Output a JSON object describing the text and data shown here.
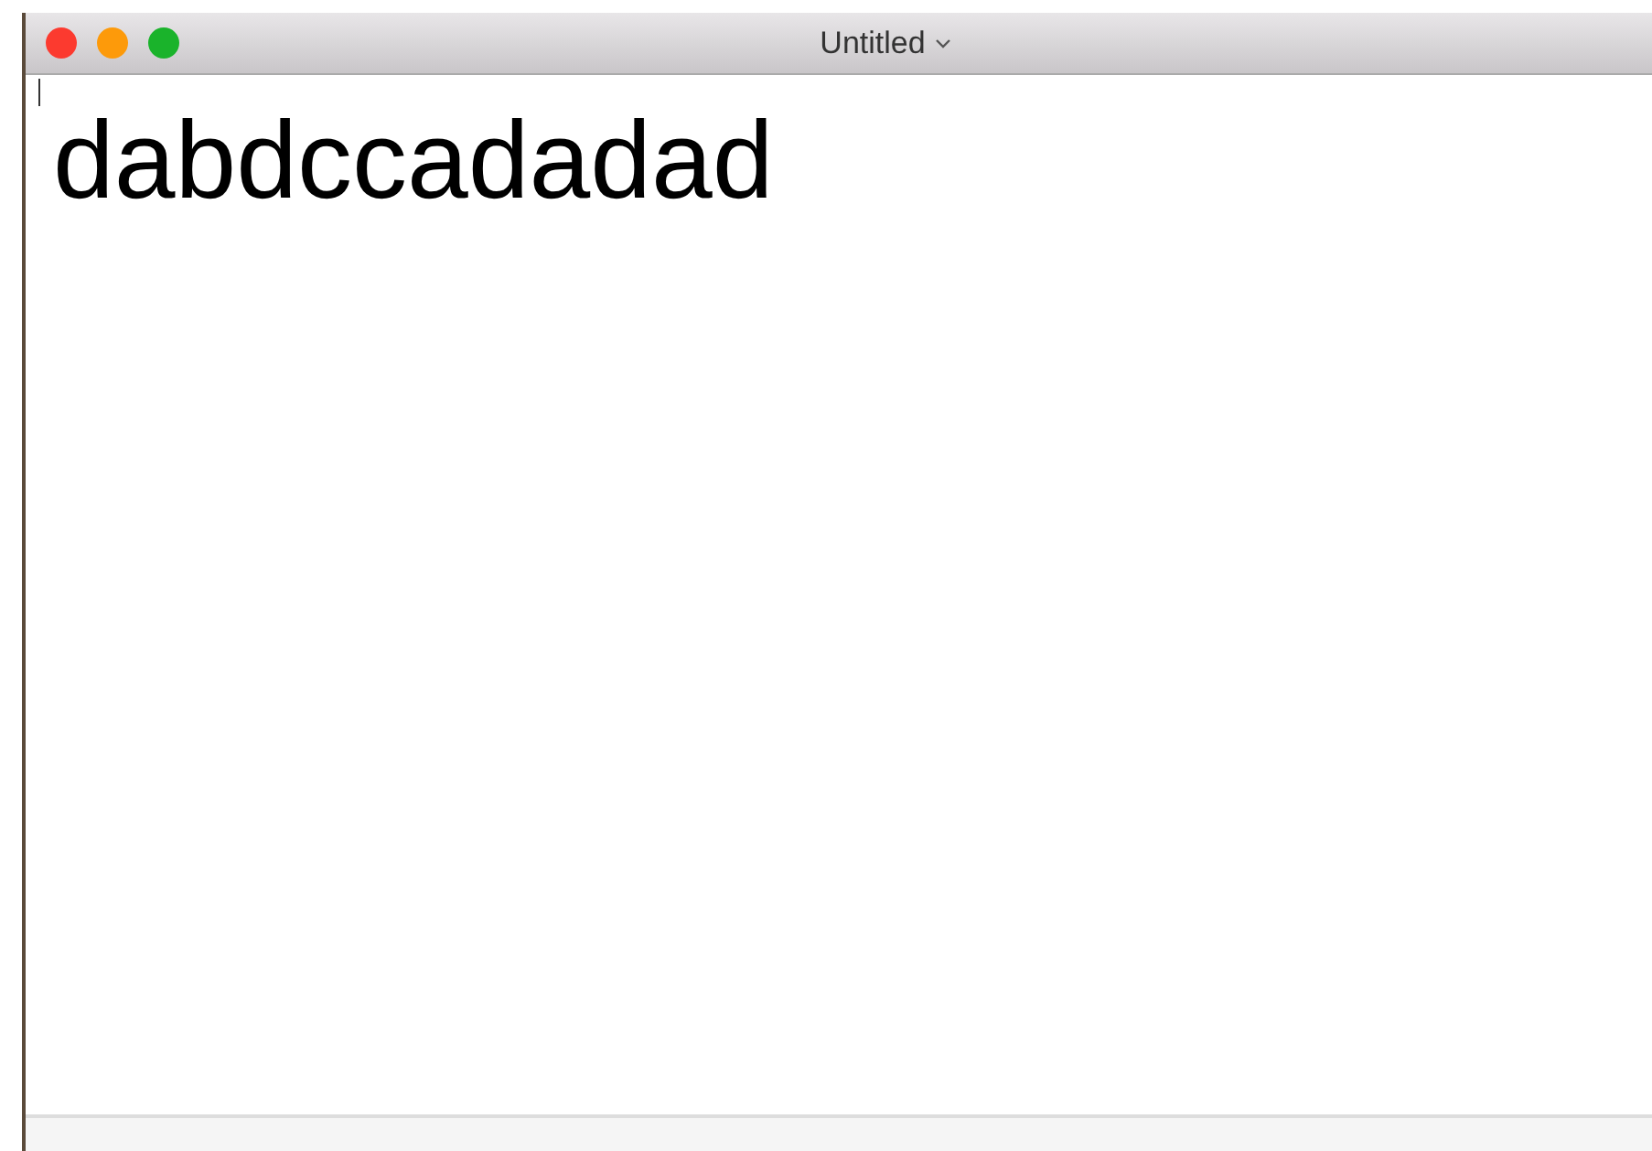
{
  "window": {
    "title": "Untitled"
  },
  "document": {
    "text": "dabdccadadad"
  }
}
